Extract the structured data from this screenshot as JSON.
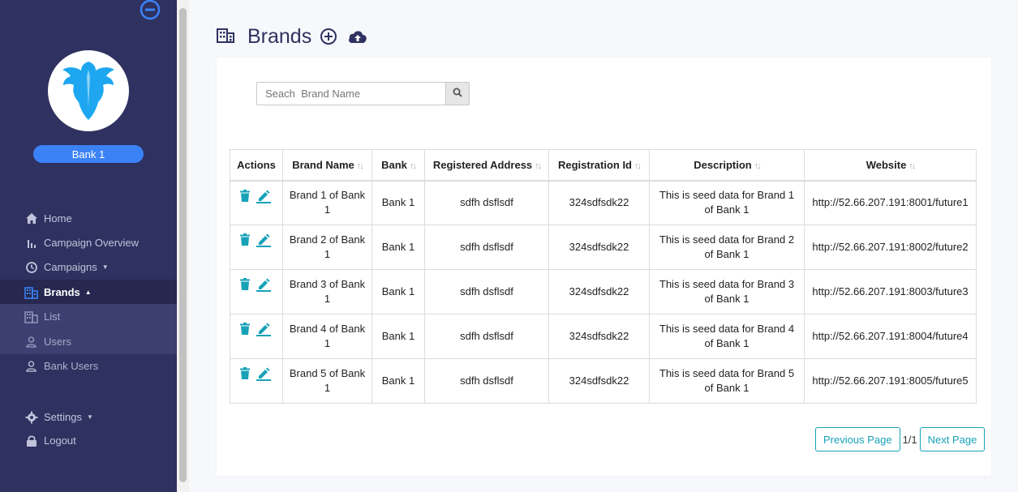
{
  "sidebar": {
    "bank_badge": "Bank 1",
    "items": [
      {
        "label": "Home",
        "icon": "home-icon"
      },
      {
        "label": "Campaign Overview",
        "icon": "bar-chart-icon"
      },
      {
        "label": "Campaigns",
        "icon": "history-icon"
      },
      {
        "label": "Brands",
        "icon": "building-icon"
      },
      {
        "label": "List",
        "icon": "building-icon"
      },
      {
        "label": "Users",
        "icon": "user-icon"
      },
      {
        "label": "Bank Users",
        "icon": "user-icon"
      },
      {
        "label": "Settings",
        "icon": "gear-icon"
      },
      {
        "label": "Logout",
        "icon": "lock-icon"
      }
    ]
  },
  "header": {
    "title": "Brands"
  },
  "search": {
    "placeholder": "Seach  Brand Name",
    "value": ""
  },
  "table": {
    "columns": [
      "Actions",
      "Brand Name",
      "Bank",
      "Registered Address",
      "Registration Id",
      "Description",
      "Website"
    ],
    "rows": [
      {
        "brand": "Brand 1 of Bank 1",
        "bank": "Bank 1",
        "address": "sdfh dsflsdf",
        "reg_id": "324sdfsdk22",
        "description": "This is seed data for Brand 1 of Bank 1",
        "website": "http://52.66.207.191:8001/future1"
      },
      {
        "brand": "Brand 2 of Bank 1",
        "bank": "Bank 1",
        "address": "sdfh dsflsdf",
        "reg_id": "324sdfsdk22",
        "description": "This is seed data for Brand 2 of Bank 1",
        "website": "http://52.66.207.191:8002/future2"
      },
      {
        "brand": "Brand 3 of Bank 1",
        "bank": "Bank 1",
        "address": "sdfh dsflsdf",
        "reg_id": "324sdfsdk22",
        "description": "This is seed data for Brand 3 of Bank 1",
        "website": "http://52.66.207.191:8003/future3"
      },
      {
        "brand": "Brand 4 of Bank 1",
        "bank": "Bank 1",
        "address": "sdfh dsflsdf",
        "reg_id": "324sdfsdk22",
        "description": "This is seed data for Brand 4 of Bank 1",
        "website": "http://52.66.207.191:8004/future4"
      },
      {
        "brand": "Brand 5 of Bank 1",
        "bank": "Bank 1",
        "address": "sdfh dsflsdf",
        "reg_id": "324sdfsdk22",
        "description": "This is seed data for Brand 5 of Bank 1",
        "website": "http://52.66.207.191:8005/future5"
      }
    ]
  },
  "pagination": {
    "prev_label": "Previous Page",
    "count": "1/1",
    "next_label": "Next Page"
  },
  "colors": {
    "sidebar_bg": "#2f3160",
    "accent_blue": "#3b82f6",
    "action_teal": "#17a2b8"
  }
}
